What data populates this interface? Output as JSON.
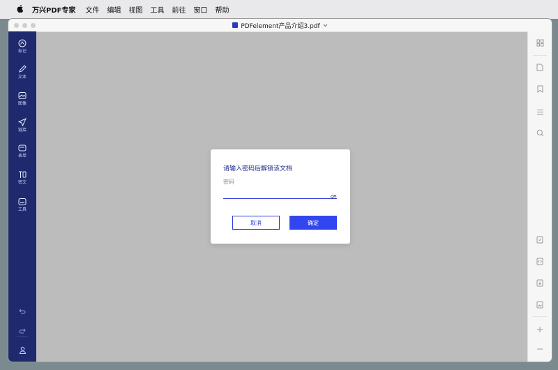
{
  "menubar": {
    "app_name": "万兴PDF专家",
    "items": [
      "文件",
      "编辑",
      "视图",
      "工具",
      "前往",
      "窗口",
      "帮助"
    ]
  },
  "window": {
    "title": "PDFelement产品介绍3.pdf"
  },
  "left_tools": [
    {
      "label": "标记",
      "icon": "markup-icon"
    },
    {
      "label": "文本",
      "icon": "pencil-icon"
    },
    {
      "label": "图像",
      "icon": "image-icon"
    },
    {
      "label": "链接",
      "icon": "link-icon"
    },
    {
      "label": "表单",
      "icon": "form-icon"
    },
    {
      "label": "密文",
      "icon": "redact-icon"
    },
    {
      "label": "工具",
      "icon": "tools-icon"
    }
  ],
  "dialog": {
    "title": "请输入密码后解锁该文档",
    "password_label": "密码",
    "password_value": "",
    "cancel_label": "取消",
    "ok_label": "确定"
  },
  "colors": {
    "sidebar": "#1f2a6e",
    "accent": "#3246ef",
    "canvas": "#bcbcbc"
  }
}
